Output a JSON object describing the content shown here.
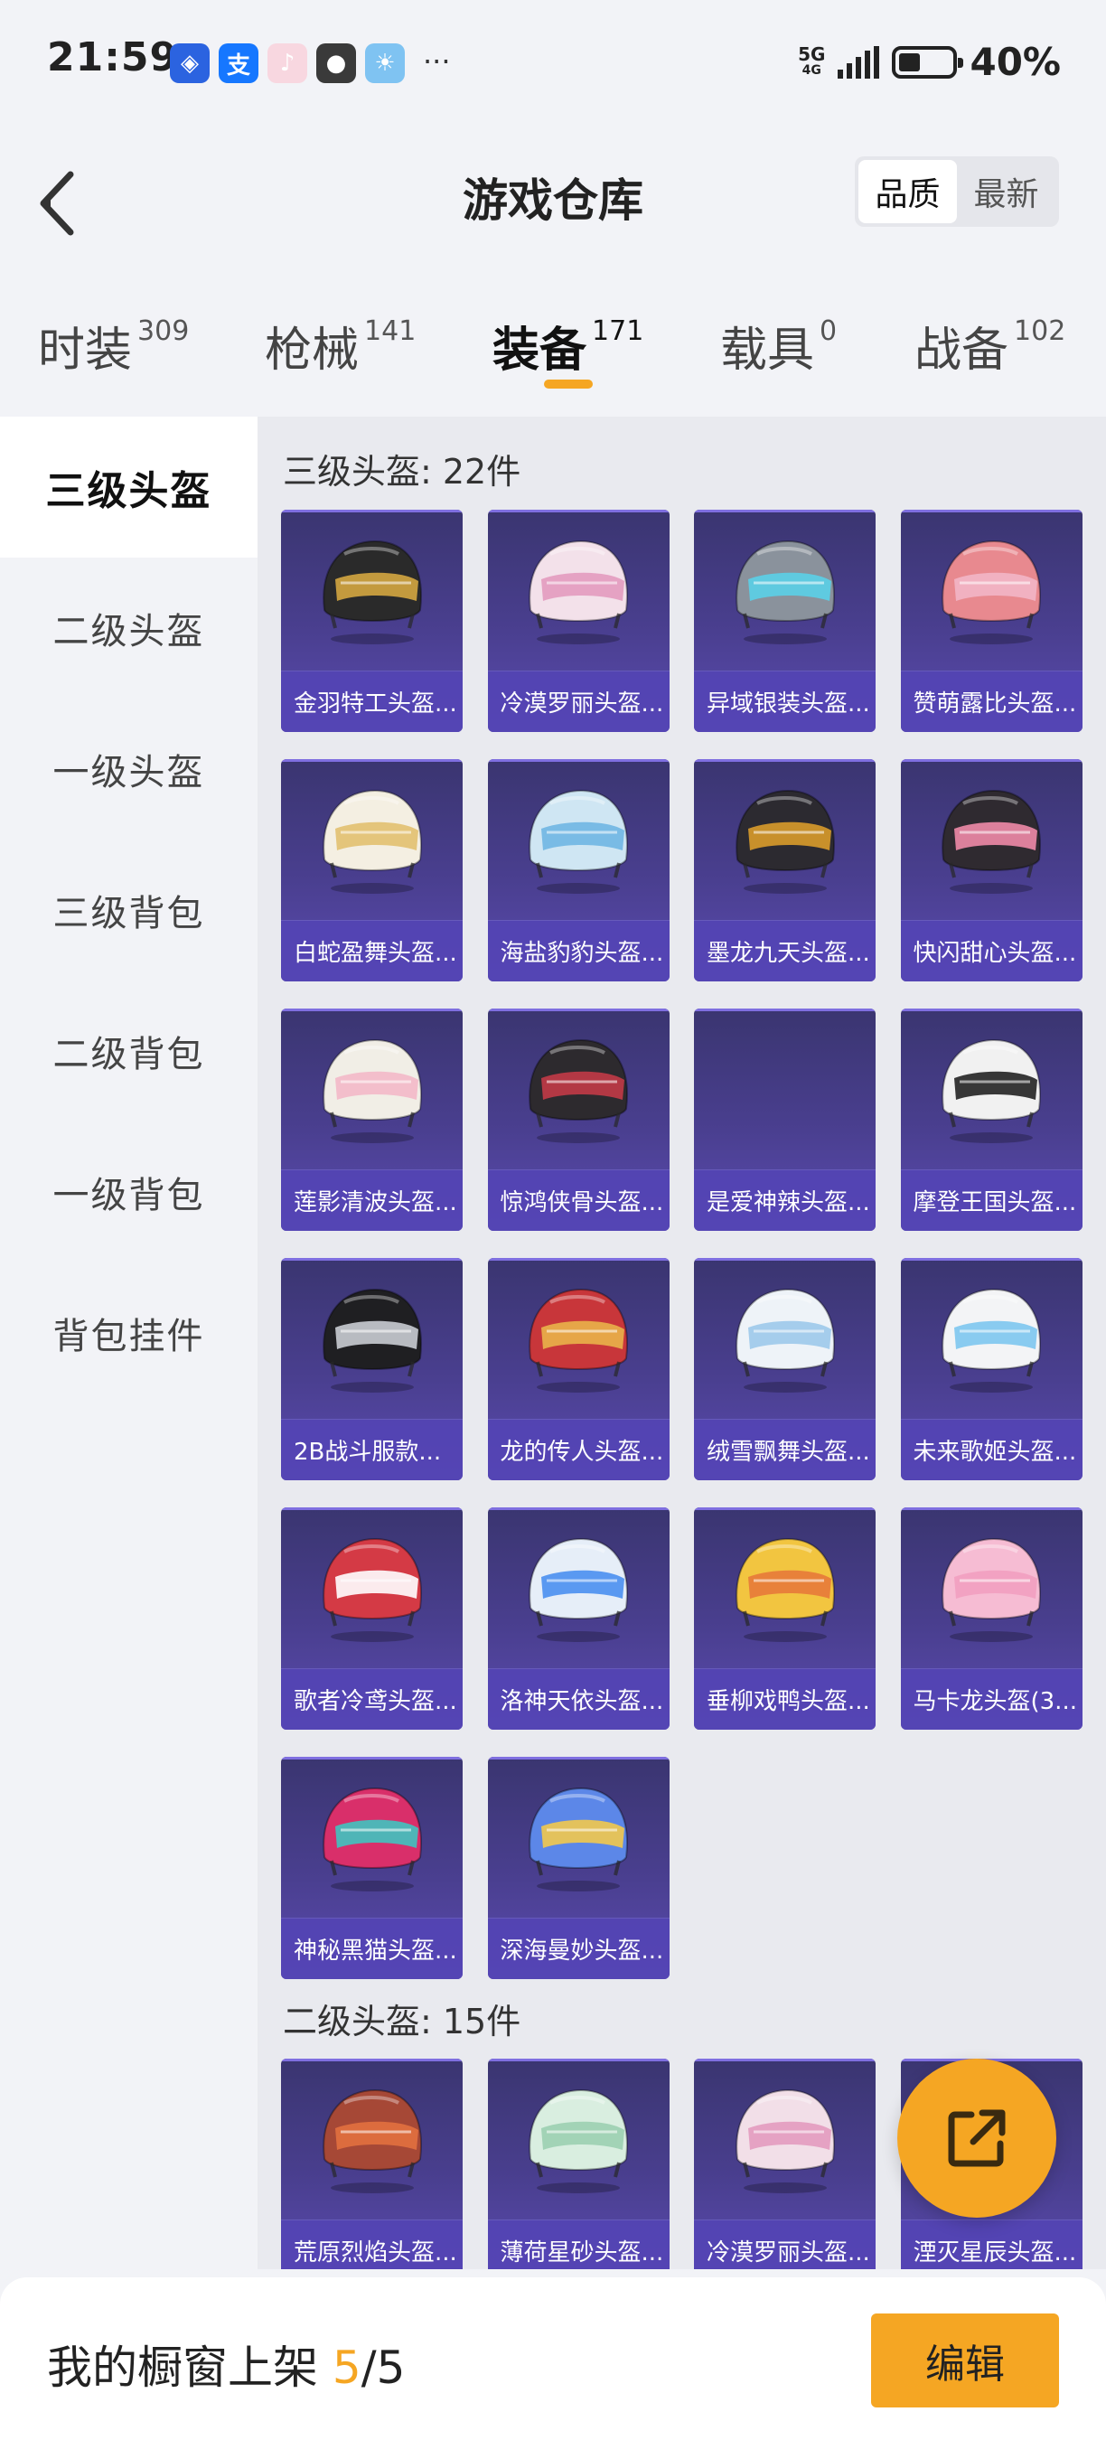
{
  "status_bar": {
    "time": "21:59",
    "network": "5G",
    "network_sub": "4G",
    "battery_percent_text": "40%",
    "battery_level": 0.4,
    "app_icons": [
      {
        "name": "app-cube-icon",
        "color": "#2b63e0",
        "glyph": "◈"
      },
      {
        "name": "alipay-icon",
        "color": "#1677ff",
        "glyph": "支"
      },
      {
        "name": "music-icon",
        "color": "#f8d7e0",
        "glyph": "♪"
      },
      {
        "name": "wechat-icon",
        "color": "#3a3a3a",
        "glyph": "●"
      },
      {
        "name": "weather-icon",
        "color": "#7fc3f2",
        "glyph": "☀"
      }
    ],
    "more": "···"
  },
  "header": {
    "title": "游戏仓库",
    "sort_options": [
      "品质",
      "最新"
    ],
    "sort_active": "品质"
  },
  "tabs": [
    {
      "label": "时装",
      "count": "309",
      "active": false
    },
    {
      "label": "枪械",
      "count": "141",
      "active": false
    },
    {
      "label": "装备",
      "count": "171",
      "active": true
    },
    {
      "label": "载具",
      "count": "0",
      "active": false
    },
    {
      "label": "战备",
      "count": "102",
      "active": false
    }
  ],
  "sidebar": {
    "items": [
      {
        "label": "三级头盔",
        "active": true
      },
      {
        "label": "二级头盔",
        "active": false
      },
      {
        "label": "一级头盔",
        "active": false
      },
      {
        "label": "三级背包",
        "active": false
      },
      {
        "label": "二级背包",
        "active": false
      },
      {
        "label": "一级背包",
        "active": false
      },
      {
        "label": "背包挂件",
        "active": false
      }
    ]
  },
  "sections": [
    {
      "title": "三级头盔: 22件",
      "items": [
        {
          "name": "金羽特工头盔...",
          "color": "#2a2a2a",
          "accent": "#d4a640"
        },
        {
          "name": "冷漠罗丽头盔...",
          "color": "#f3e1ea",
          "accent": "#e39bbf"
        },
        {
          "name": "异域银装头盔...",
          "color": "#8a929c",
          "accent": "#5ad0e8"
        },
        {
          "name": "赞萌露比头盔...",
          "color": "#e8898f",
          "accent": "#f2b6c6"
        },
        {
          "name": "白蛇盈舞头盔...",
          "color": "#f4efe2",
          "accent": "#e2c070"
        },
        {
          "name": "海盐豹豹头盔...",
          "color": "#cfe6f3",
          "accent": "#6fb6e3"
        },
        {
          "name": "墨龙九天头盔...",
          "color": "#2c2a30",
          "accent": "#d99b2b"
        },
        {
          "name": "快闪甜心头盔...",
          "color": "#2f2a30",
          "accent": "#f08aa8"
        },
        {
          "name": "莲影清波头盔...",
          "color": "#f1eee6",
          "accent": "#f3b8c8"
        },
        {
          "name": "惊鸿侠骨头盔...",
          "color": "#2d2a2e",
          "accent": "#c23a47"
        },
        {
          "name": "是爱神辣头盔...",
          "color": "",
          "accent": ""
        },
        {
          "name": "摩登王国头盔...",
          "color": "#f1f1f1",
          "accent": "#222222"
        },
        {
          "name": "2B战斗服款...",
          "color": "#1f1f22",
          "accent": "#c9ccd3"
        },
        {
          "name": "龙的传人头盔...",
          "color": "#c8363a",
          "accent": "#e9b24a"
        },
        {
          "name": "绒雪飘舞头盔...",
          "color": "#eef3f8",
          "accent": "#9cc9ea"
        },
        {
          "name": "未来歌姬头盔...",
          "color": "#f3f4f6",
          "accent": "#7dc7f0"
        },
        {
          "name": "歌者冷鸢头盔...",
          "color": "#d43a45",
          "accent": "#ffffff"
        },
        {
          "name": "洛神天依头盔...",
          "color": "#e6eef8",
          "accent": "#4a8ff0"
        },
        {
          "name": "垂柳戏鸭头盔...",
          "color": "#f2c540",
          "accent": "#e7793a"
        },
        {
          "name": "马卡龙头盔(3...",
          "color": "#f6bcd3",
          "accent": "#f29fc0"
        },
        {
          "name": "神秘黑猫头盔...",
          "color": "#d92f6a",
          "accent": "#3fc4c0"
        },
        {
          "name": "深海曼妙头盔...",
          "color": "#5c87e8",
          "accent": "#f2c94c"
        }
      ]
    },
    {
      "title": "二级头盔: 15件",
      "items": [
        {
          "name": "荒原烈焰头盔...",
          "color": "#a64836",
          "accent": "#e2703f"
        },
        {
          "name": "薄荷星砂头盔...",
          "color": "#d9eee0",
          "accent": "#9bcfb1"
        },
        {
          "name": "冷漠罗丽头盔...",
          "color": "#f2dfe8",
          "accent": "#e39bbf"
        },
        {
          "name": "湮灭星辰头盔...",
          "color": "#3a3648",
          "accent": "#9c86e0"
        }
      ]
    }
  ],
  "bottom_bar": {
    "showcase_label": "我的橱窗上架 ",
    "showcase_current": "5",
    "showcase_sep": "/",
    "showcase_total": "5",
    "edit_label": "编辑"
  },
  "fab": {
    "icon": "share-external-icon"
  }
}
